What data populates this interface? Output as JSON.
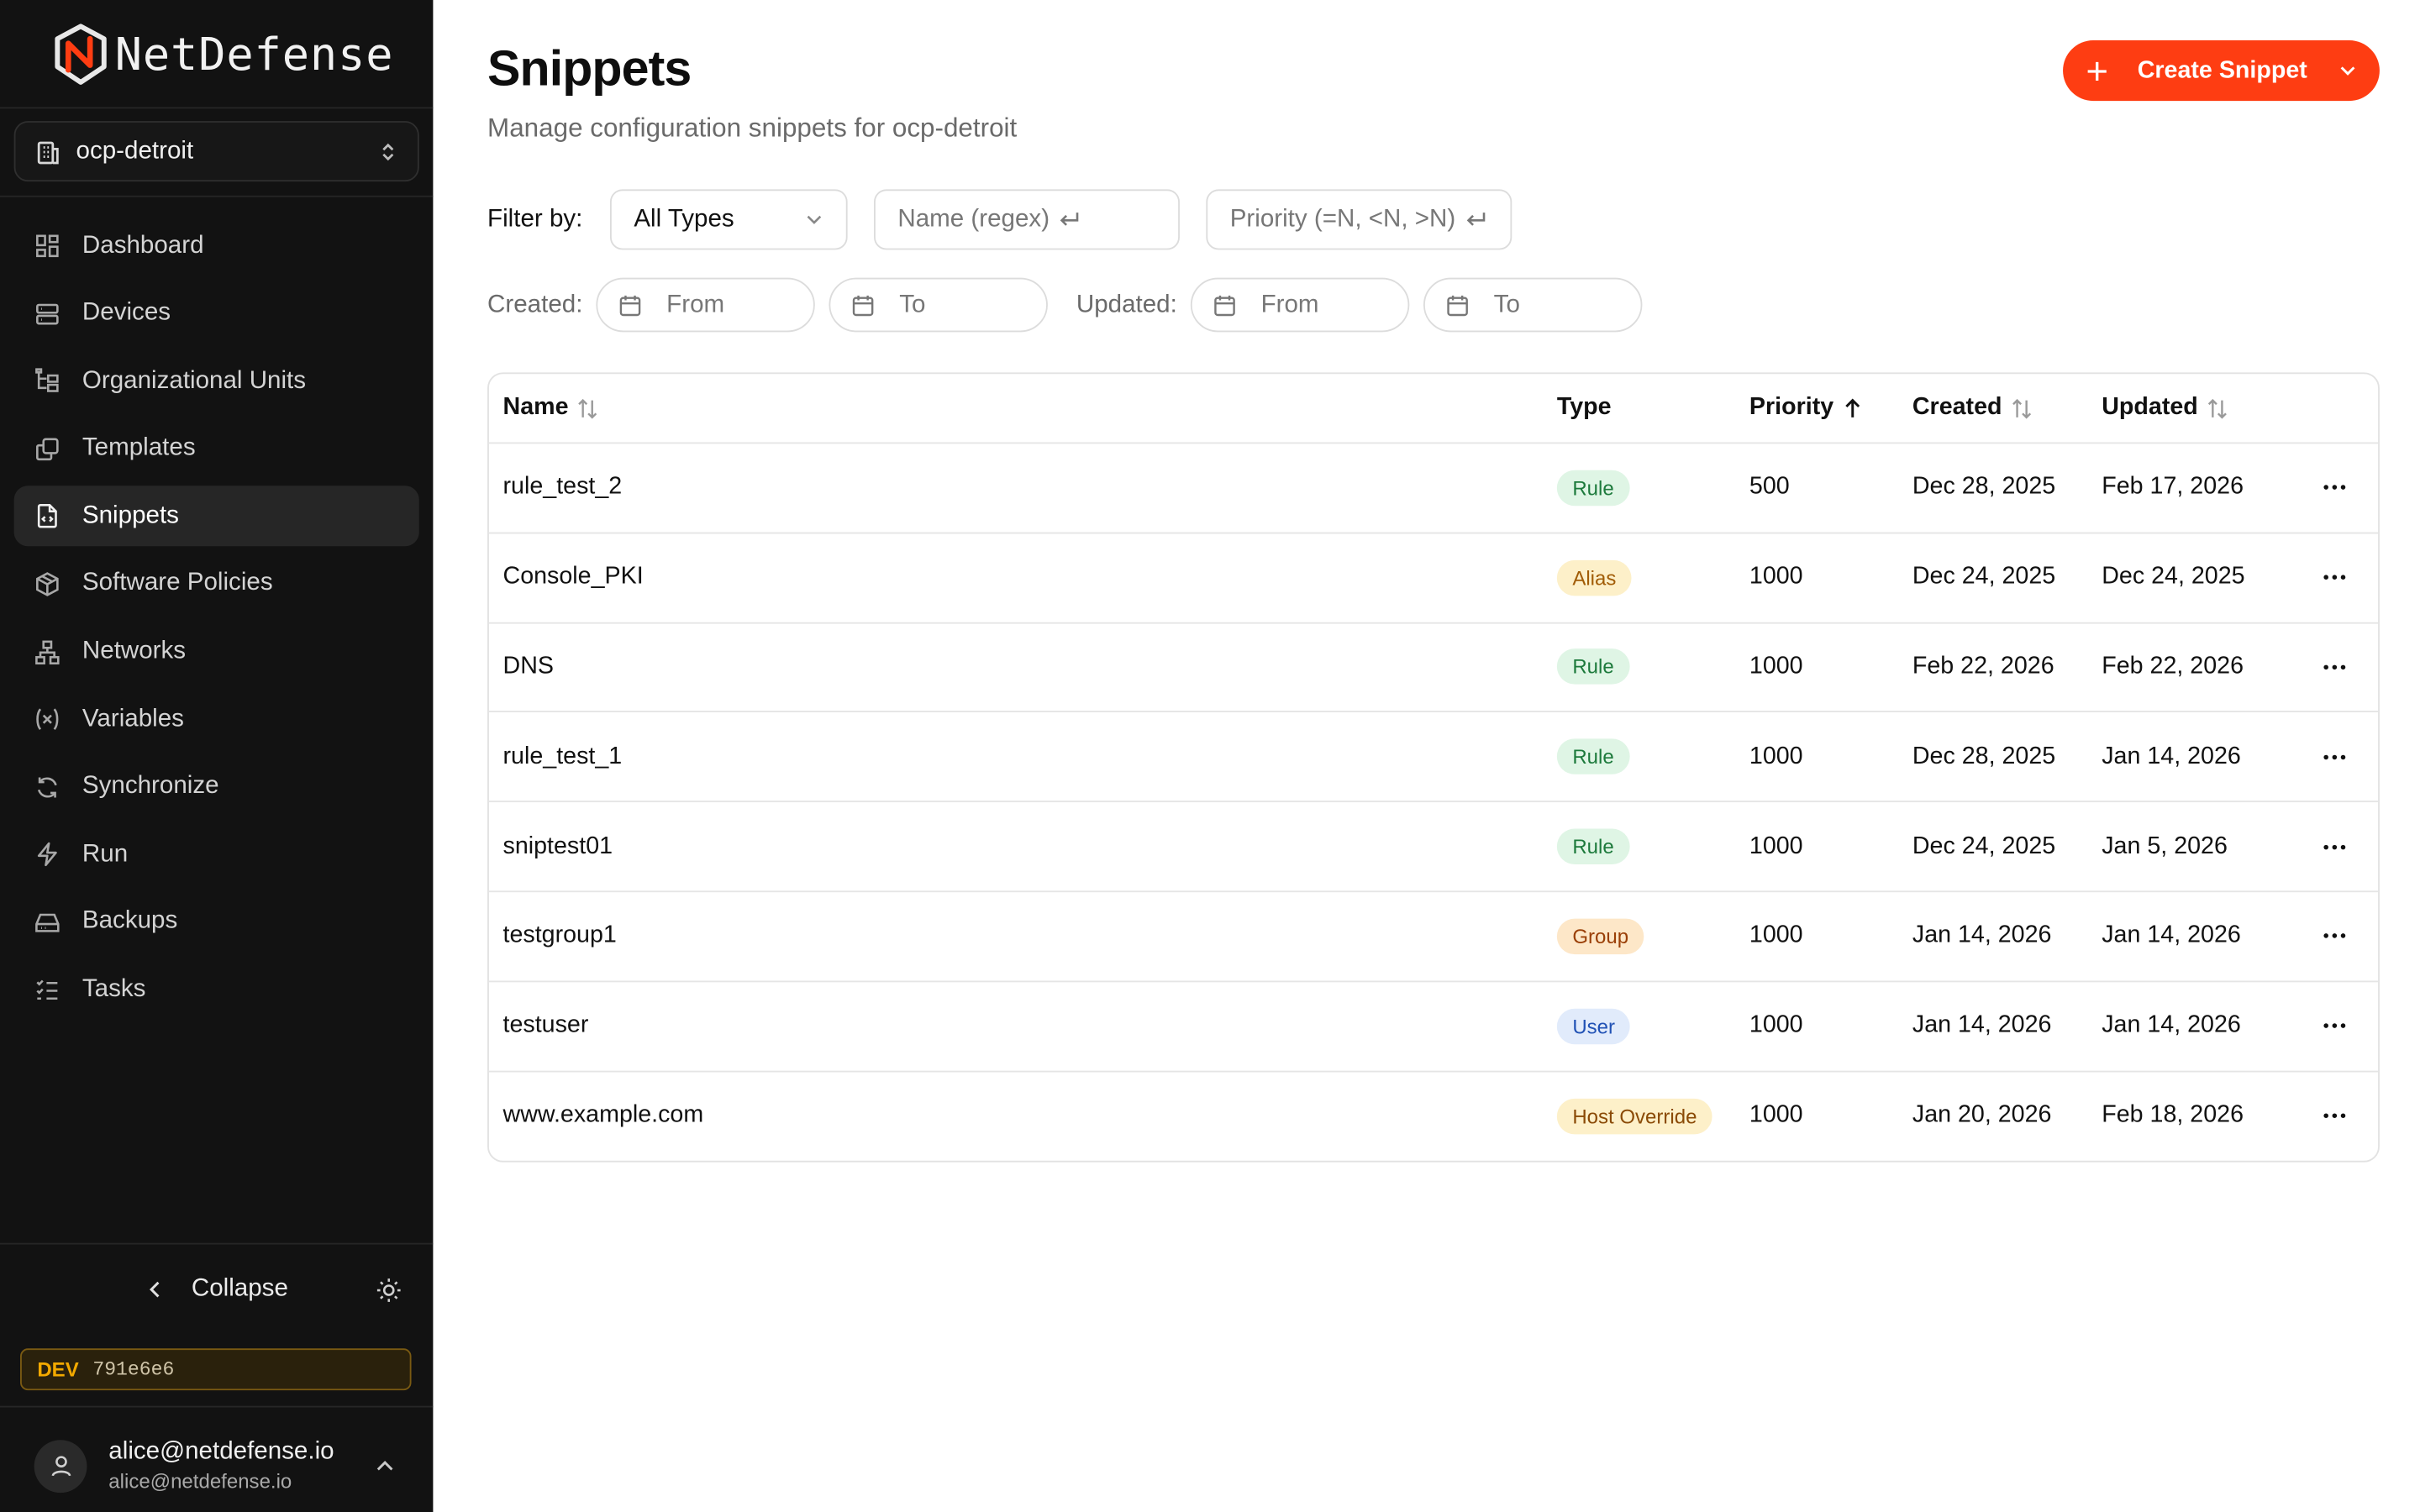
{
  "brand": {
    "name": "NetDefense",
    "accent": "#fe3d12"
  },
  "org_selector": {
    "current": "ocp-detroit"
  },
  "sidebar": {
    "items": [
      {
        "label": "Dashboard",
        "icon": "dashboard-icon"
      },
      {
        "label": "Devices",
        "icon": "server-icon"
      },
      {
        "label": "Organizational Units",
        "icon": "hierarchy-icon"
      },
      {
        "label": "Templates",
        "icon": "templates-icon"
      },
      {
        "label": "Snippets",
        "icon": "snippet-file-icon",
        "active": true
      },
      {
        "label": "Software Policies",
        "icon": "package-icon"
      },
      {
        "label": "Networks",
        "icon": "network-icon"
      },
      {
        "label": "Variables",
        "icon": "variable-icon"
      },
      {
        "label": "Synchronize",
        "icon": "sync-icon"
      },
      {
        "label": "Run",
        "icon": "bolt-icon"
      },
      {
        "label": "Backups",
        "icon": "drive-icon"
      },
      {
        "label": "Tasks",
        "icon": "list-checks-icon"
      }
    ],
    "collapse_label": "Collapse",
    "env_badge": {
      "tag": "DEV",
      "hash": "791e6e6"
    },
    "user": {
      "name": "alice@netdefense.io",
      "email": "alice@netdefense.io"
    }
  },
  "header": {
    "title": "Snippets",
    "subtitle": "Manage configuration snippets for ocp-detroit",
    "create_button": "Create Snippet"
  },
  "filters": {
    "filter_by_label": "Filter by:",
    "type_value": "All Types",
    "name_placeholder": "Name (regex)",
    "priority_placeholder": "Priority (=N, <N, >N)",
    "created_label": "Created:",
    "updated_label": "Updated:",
    "from_placeholder": "From",
    "to_placeholder": "To"
  },
  "table": {
    "columns": {
      "name": "Name",
      "type": "Type",
      "priority": "Priority",
      "created": "Created",
      "updated": "Updated"
    },
    "sorted_by": "priority",
    "rows": [
      {
        "name": "rule_test_2",
        "type": "Rule",
        "priority": "500",
        "created": "Dec 28, 2025",
        "updated": "Feb 17, 2026"
      },
      {
        "name": "Console_PKI",
        "type": "Alias",
        "priority": "1000",
        "created": "Dec 24, 2025",
        "updated": "Dec 24, 2025"
      },
      {
        "name": "DNS",
        "type": "Rule",
        "priority": "1000",
        "created": "Feb 22, 2026",
        "updated": "Feb 22, 2026"
      },
      {
        "name": "rule_test_1",
        "type": "Rule",
        "priority": "1000",
        "created": "Dec 28, 2025",
        "updated": "Jan 14, 2026"
      },
      {
        "name": "sniptest01",
        "type": "Rule",
        "priority": "1000",
        "created": "Dec 24, 2025",
        "updated": "Jan 5, 2026"
      },
      {
        "name": "testgroup1",
        "type": "Group",
        "priority": "1000",
        "created": "Jan 14, 2026",
        "updated": "Jan 14, 2026"
      },
      {
        "name": "testuser",
        "type": "User",
        "priority": "1000",
        "created": "Jan 14, 2026",
        "updated": "Jan 14, 2026"
      },
      {
        "name": "www.example.com",
        "type": "Host Override",
        "priority": "1000",
        "created": "Jan 20, 2026",
        "updated": "Feb 18, 2026"
      }
    ]
  }
}
